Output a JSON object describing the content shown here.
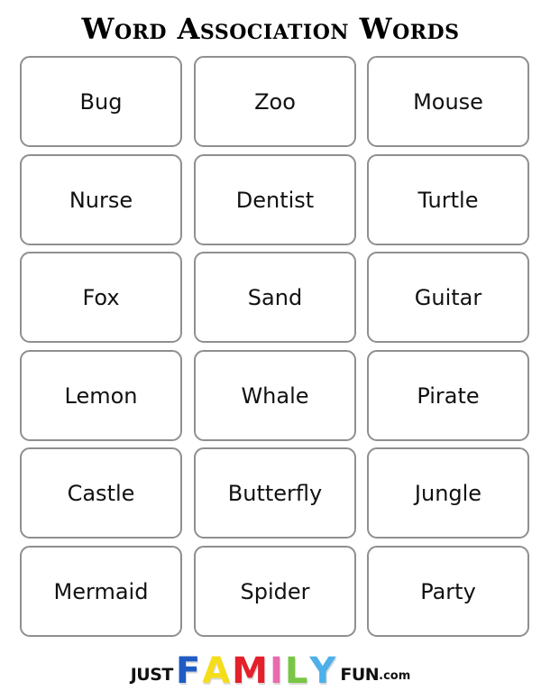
{
  "title": "Word Association Words",
  "words": [
    [
      "Bug",
      "Zoo",
      "Mouse"
    ],
    [
      "Nurse",
      "Dentist",
      "Turtle"
    ],
    [
      "Fox",
      "Sand",
      "Guitar"
    ],
    [
      "Lemon",
      "Whale",
      "Pirate"
    ],
    [
      "Castle",
      "Butterfly",
      "Jungle"
    ],
    [
      "Mermaid",
      "Spider",
      "Party"
    ]
  ],
  "logo": {
    "prefix": "JUST",
    "letters": [
      {
        "char": "F",
        "color": "#1f5cc4"
      },
      {
        "char": "A",
        "color": "#f5dd1a"
      },
      {
        "char": "M",
        "color": "#e3202b"
      },
      {
        "char": "I",
        "color": "#e86bb0"
      },
      {
        "char": "L",
        "color": "#78c646"
      },
      {
        "char": "Y",
        "color": "#4eb0ea"
      }
    ],
    "suffix": "FUN",
    "domain": ".com"
  }
}
